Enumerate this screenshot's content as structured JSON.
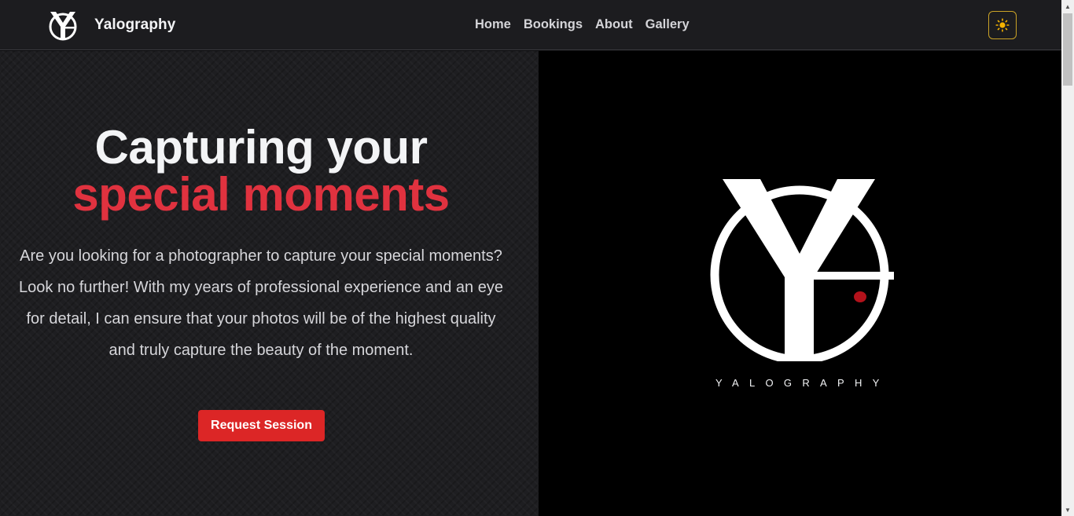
{
  "nav": {
    "brand_name": "Yalography",
    "links": [
      {
        "label": "Home"
      },
      {
        "label": "Bookings"
      },
      {
        "label": "About"
      },
      {
        "label": "Gallery"
      }
    ],
    "theme_icon": "sun-icon"
  },
  "hero": {
    "title_line1": "Capturing your",
    "title_line2": "special moments",
    "description": "Are you looking for a photographer to capture your special moments? Look no further! With my years of professional experience and an eye for detail, I can ensure that your photos will be of the highest quality and truly capture the beauty of the moment.",
    "cta_label": "Request Session",
    "logo_wordmark": "YALOGRAPHY"
  },
  "colors": {
    "accent": "#e0323f",
    "button": "#dc2626",
    "nav_bg": "#1c1c1f",
    "toggle_border": "#c9a227"
  }
}
